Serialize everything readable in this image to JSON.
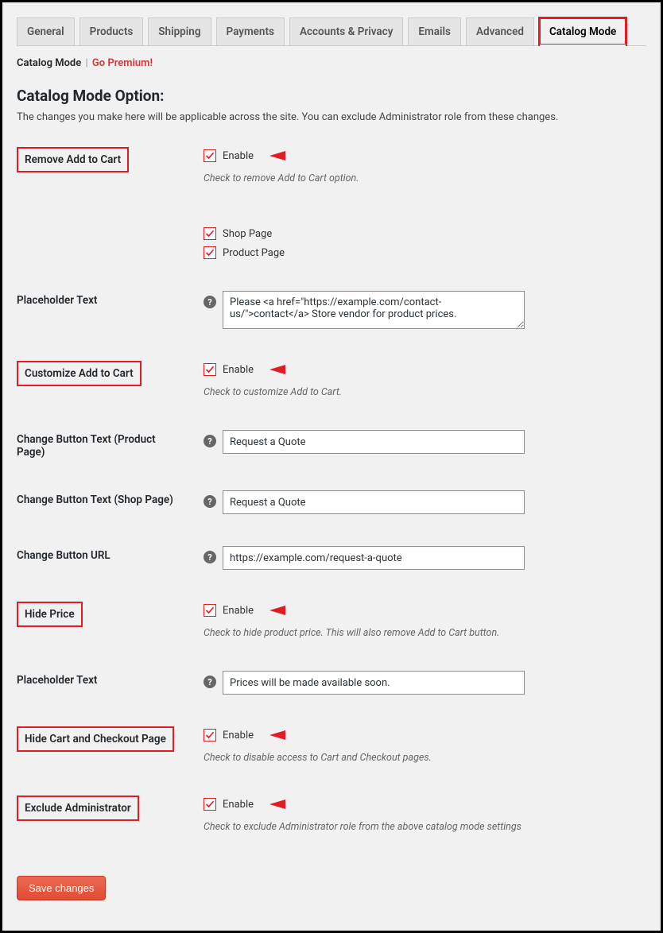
{
  "tabs": [
    "General",
    "Products",
    "Shipping",
    "Payments",
    "Accounts & Privacy",
    "Emails",
    "Advanced",
    "Catalog Mode"
  ],
  "activeTab": "Catalog Mode",
  "subnav": {
    "current": "Catalog Mode",
    "premium": "Go Premium!"
  },
  "section": {
    "title": "Catalog Mode Option:",
    "desc": "The changes you make here will be applicable across the site. You can exclude Administrator role from these changes."
  },
  "labels": {
    "enable": "Enable",
    "shop_page": "Shop Page",
    "product_page": "Product Page"
  },
  "rows": {
    "remove_add_to_cart": {
      "label": "Remove Add to Cart",
      "desc": "Check to remove Add to Cart option."
    },
    "placeholder_text1": {
      "label": "Placeholder Text",
      "value": "Please <a href=\"https://example.com/contact-us/\">contact</a> Store vendor for product prices."
    },
    "customize_add_to_cart": {
      "label": "Customize Add to Cart",
      "desc": "Check to customize Add to Cart."
    },
    "change_btn_product": {
      "label": "Change Button Text (Product Page)",
      "value": "Request a Quote"
    },
    "change_btn_shop": {
      "label": "Change Button Text (Shop Page)",
      "value": "Request a Quote"
    },
    "change_btn_url": {
      "label": "Change Button URL",
      "value": "https://example.com/request-a-quote"
    },
    "hide_price": {
      "label": "Hide Price",
      "desc": "Check to hide product price. This will also remove Add to Cart button."
    },
    "placeholder_text2": {
      "label": "Placeholder Text",
      "value": "Prices will be made available soon."
    },
    "hide_cart_checkout": {
      "label": "Hide Cart and Checkout Page",
      "desc": "Check to disable access to Cart and Checkout pages."
    },
    "exclude_admin": {
      "label": "Exclude Administrator",
      "desc": "Check to exclude Administrator role from the above catalog mode settings"
    }
  },
  "save_button": "Save changes"
}
